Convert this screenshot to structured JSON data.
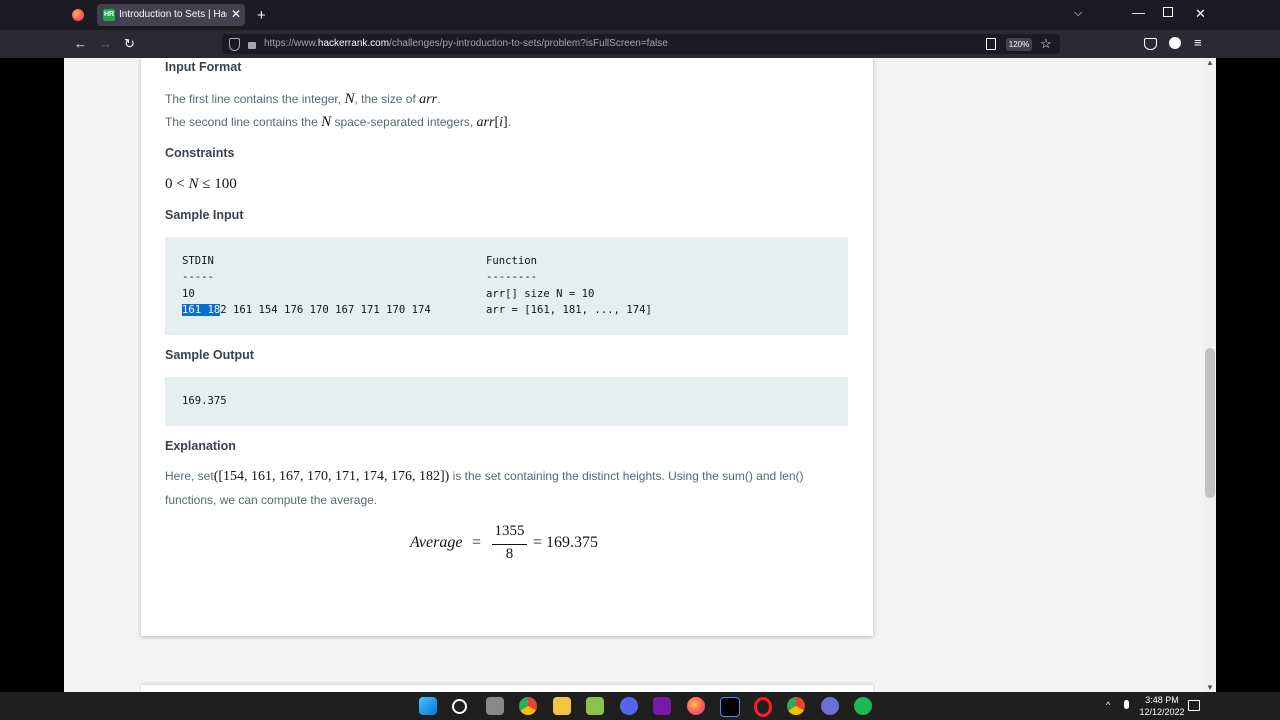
{
  "browser": {
    "tab_title": "Introduction to Sets | HackerRank",
    "tab_favicon": "HR",
    "url_prefix": "https://www.",
    "url_domain": "hackerrank.com",
    "url_path": "/challenges/py-introduction-to-sets/problem?isFullScreen=false",
    "zoom": "120%"
  },
  "content": {
    "input_format_heading": "Input Format",
    "line1_pre": "The first line contains the integer, ",
    "line1_N": "N",
    "line1_mid": ", the size of ",
    "line1_arr": "arr",
    "line1_end": ".",
    "line2_pre": "The second line contains the ",
    "line2_N": "N",
    "line2_mid": " space-separated integers, ",
    "line2_arr": "arr",
    "line2_i": "i",
    "line2_end": ".",
    "constraints_heading": "Constraints",
    "constraint_0": "0",
    "constraint_lt": " < ",
    "constraint_N": "N",
    "constraint_le": " ≤ 100",
    "sample_input_heading": "Sample Input",
    "stdin_label": "STDIN",
    "stdin_dash": "-----",
    "stdin_line1": "10",
    "stdin_line2_selected": "161 18",
    "stdin_line2_rest": "2 161 154 176 170 167 171 170 174",
    "func_label": "Function",
    "func_dash": "--------",
    "func_line1": "arr[] size N = 10",
    "func_line2": "arr = [161, 181, ..., 174]",
    "sample_output_heading": "Sample Output",
    "sample_output_value": "169.375",
    "explanation_heading": "Explanation",
    "expl_pre": "Here, set",
    "expl_set": "([154, 161, 167, 170, 171, 174, 176, 182])",
    "expl_post": " is the set containing the distinct heights. Using the sum() and len()",
    "expl_line2": "functions, we can compute the average.",
    "avg_label": "Average",
    "avg_eq": "=",
    "avg_num": "1355",
    "avg_den": "8",
    "avg_result": "= 169.375"
  },
  "taskbar": {
    "time": "3:48 PM",
    "date": "12/12/2022"
  }
}
